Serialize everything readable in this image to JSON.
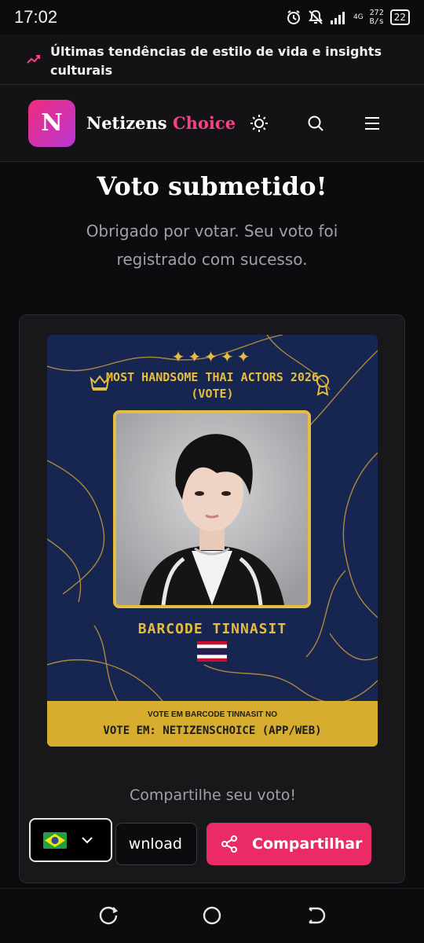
{
  "status_bar": {
    "time": "17:02",
    "network": "4G",
    "speed_value": "272",
    "speed_unit": "B/s",
    "battery": "22"
  },
  "ticker": {
    "text": "Últimas tendências de estilo de vida e insights culturais",
    "icon": "trending-up-icon"
  },
  "header": {
    "logo_letter": "N",
    "brand_main": "Netizens",
    "brand_accent": "Choice",
    "icons": [
      "sun-icon",
      "search-icon",
      "menu-icon"
    ]
  },
  "page": {
    "title": "Voto submetido!",
    "subtitle": "Obrigado por votar. Seu voto foi registrado com sucesso."
  },
  "poster": {
    "stars": "✦✦✦✦✦",
    "title": "MOST HANDSOME THAI ACTORS 2026 (VOTE)",
    "actor_name": "BARCODE TINNASIT",
    "footer_small": "VOTE EM BARCODE TINNASIT NO",
    "footer_big": "VOTE EM: NETIZENSCHOICE (APP/WEB)"
  },
  "share": {
    "label": "Compartilhe seu voto!",
    "download_label": "wnload",
    "share_label": "Compartilhar"
  },
  "colors": {
    "accent_pink": "#ea2b66",
    "gold": "#e7bd3f",
    "navy": "#15234a"
  }
}
